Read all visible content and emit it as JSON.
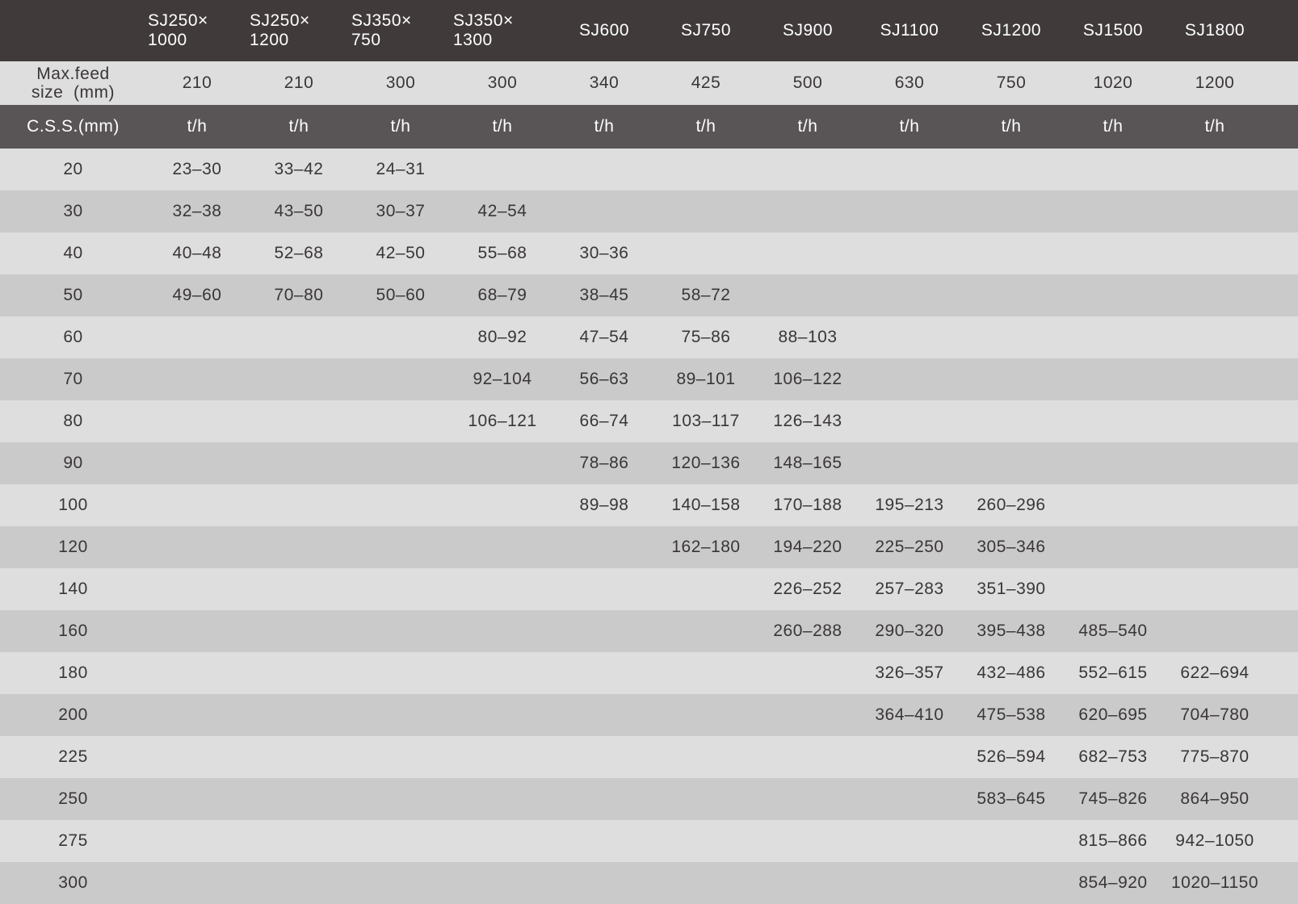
{
  "table": {
    "models": [
      [
        "SJ250×",
        "1000"
      ],
      [
        "SJ250×",
        "1200"
      ],
      [
        "SJ350×",
        "750"
      ],
      [
        "SJ350×",
        "1300"
      ],
      [
        "SJ600"
      ],
      [
        "SJ750"
      ],
      [
        "SJ900"
      ],
      [
        "SJ1100"
      ],
      [
        "SJ1200"
      ],
      [
        "SJ1500"
      ],
      [
        "SJ1800"
      ]
    ],
    "feed_label": [
      "Max.feed",
      "size  (mm)"
    ],
    "feed_sizes": [
      "210",
      "210",
      "300",
      "300",
      "340",
      "425",
      "500",
      "630",
      "750",
      "1020",
      "1200"
    ],
    "css_label": "C.S.S.(mm)",
    "unit": "t/h",
    "rows": [
      {
        "css": "20",
        "values": [
          "23–30",
          "33–42",
          "24–31",
          "",
          "",
          "",
          "",
          "",
          "",
          "",
          ""
        ]
      },
      {
        "css": "30",
        "values": [
          "32–38",
          "43–50",
          "30–37",
          "42–54",
          "",
          "",
          "",
          "",
          "",
          "",
          ""
        ]
      },
      {
        "css": "40",
        "values": [
          "40–48",
          "52–68",
          "42–50",
          "55–68",
          "30–36",
          "",
          "",
          "",
          "",
          "",
          ""
        ]
      },
      {
        "css": "50",
        "values": [
          "49–60",
          "70–80",
          "50–60",
          "68–79",
          "38–45",
          "58–72",
          "",
          "",
          "",
          "",
          ""
        ]
      },
      {
        "css": "60",
        "values": [
          "",
          "",
          "",
          "80–92",
          "47–54",
          "75–86",
          "88–103",
          "",
          "",
          "",
          ""
        ]
      },
      {
        "css": "70",
        "values": [
          "",
          "",
          "",
          "92–104",
          "56–63",
          "89–101",
          "106–122",
          "",
          "",
          "",
          ""
        ]
      },
      {
        "css": "80",
        "values": [
          "",
          "",
          "",
          "106–121",
          "66–74",
          "103–117",
          "126–143",
          "",
          "",
          "",
          ""
        ]
      },
      {
        "css": "90",
        "values": [
          "",
          "",
          "",
          "",
          "78–86",
          "120–136",
          "148–165",
          "",
          "",
          "",
          ""
        ]
      },
      {
        "css": "100",
        "values": [
          "",
          "",
          "",
          "",
          "89–98",
          "140–158",
          "170–188",
          "195–213",
          "260–296",
          "",
          ""
        ]
      },
      {
        "css": "120",
        "values": [
          "",
          "",
          "",
          "",
          "",
          "162–180",
          "194–220",
          "225–250",
          "305–346",
          "",
          ""
        ]
      },
      {
        "css": "140",
        "values": [
          "",
          "",
          "",
          "",
          "",
          "",
          "226–252",
          "257–283",
          "351–390",
          "",
          ""
        ]
      },
      {
        "css": "160",
        "values": [
          "",
          "",
          "",
          "",
          "",
          "",
          "260–288",
          "290–320",
          "395–438",
          "485–540",
          ""
        ]
      },
      {
        "css": "180",
        "values": [
          "",
          "",
          "",
          "",
          "",
          "",
          "",
          "326–357",
          "432–486",
          "552–615",
          "622–694"
        ]
      },
      {
        "css": "200",
        "values": [
          "",
          "",
          "",
          "",
          "",
          "",
          "",
          "364–410",
          "475–538",
          "620–695",
          "704–780"
        ]
      },
      {
        "css": "225",
        "values": [
          "",
          "",
          "",
          "",
          "",
          "",
          "",
          "",
          "526–594",
          "682–753",
          "775–870"
        ]
      },
      {
        "css": "250",
        "values": [
          "",
          "",
          "",
          "",
          "",
          "",
          "",
          "",
          "583–645",
          "745–826",
          "864–950"
        ]
      },
      {
        "css": "275",
        "values": [
          "",
          "",
          "",
          "",
          "",
          "",
          "",
          "",
          "",
          "815–866",
          "942–1050"
        ]
      },
      {
        "css": "300",
        "values": [
          "",
          "",
          "",
          "",
          "",
          "",
          "",
          "",
          "",
          "854–920",
          "1020–1150"
        ]
      }
    ]
  }
}
